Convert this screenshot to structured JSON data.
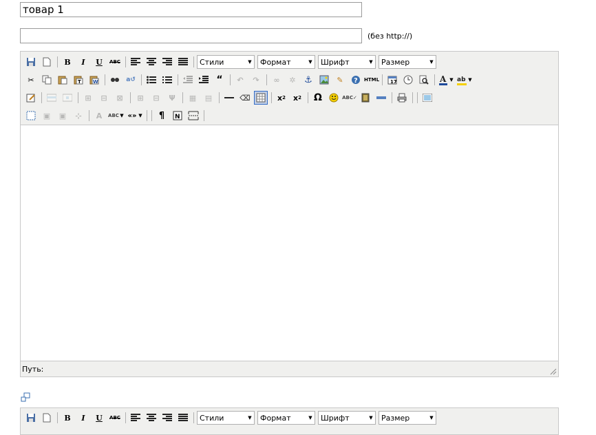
{
  "product_name": {
    "value": "товар 1"
  },
  "url_field": {
    "value": "",
    "hint": "(без http://)"
  },
  "editor": {
    "selects": {
      "styles": "Стили",
      "format": "Формат",
      "font": "Шрифт",
      "size": "Размер"
    },
    "statusbar": {
      "path_label": "Путь:"
    }
  },
  "icons": [
    "save-icon",
    "new-document-icon",
    "bold-icon",
    "italic-icon",
    "underline-icon",
    "strikethrough-icon",
    "align-left-icon",
    "align-center-icon",
    "align-right-icon",
    "align-justify-icon",
    "cut-icon",
    "copy-icon",
    "paste-icon",
    "paste-text-icon",
    "paste-word-icon",
    "search-icon",
    "replace-icon",
    "bullet-list-icon",
    "numbered-list-icon",
    "outdent-icon",
    "indent-icon",
    "blockquote-icon",
    "undo-icon",
    "redo-icon",
    "link-icon",
    "unlink-icon",
    "anchor-icon",
    "image-icon",
    "cleanup-icon",
    "help-icon",
    "html-source-icon",
    "insert-date-icon",
    "insert-time-icon",
    "preview-icon",
    "text-color-icon",
    "highlight-color-icon",
    "table-icon",
    "horizontal-rule-icon",
    "eraser-icon",
    "visual-aid-icon",
    "subscript-icon",
    "superscript-icon",
    "special-char-icon",
    "emoticon-icon",
    "spellcheck-icon",
    "media-icon",
    "advanced-hr-icon",
    "print-icon",
    "fullscreen-icon",
    "insert-layer-icon",
    "visual-chars-icon",
    "nonbreaking-icon",
    "pagebreak-icon"
  ]
}
